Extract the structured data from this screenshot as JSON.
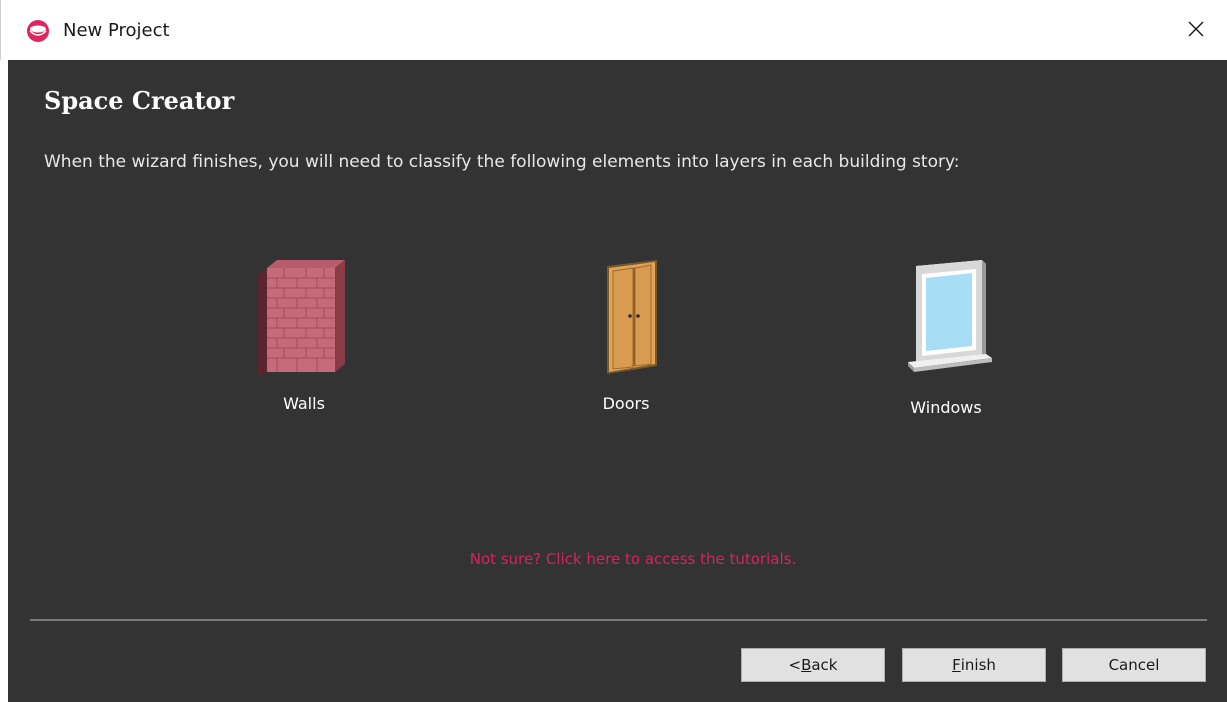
{
  "window": {
    "title": "New Project",
    "app_icon": "app-logo-icon",
    "close_icon": "close-icon"
  },
  "page": {
    "heading": "Space Creator",
    "instruction": "When the wizard finishes, you will need to classify the following elements into layers in each building story:"
  },
  "elements": [
    {
      "label": "Walls",
      "icon": "wall-icon"
    },
    {
      "label": "Doors",
      "icon": "door-icon"
    },
    {
      "label": "Windows",
      "icon": "window-icon"
    }
  ],
  "tutorial_link": "Not sure? Click here to access the tutorials.",
  "buttons": {
    "back": {
      "prefix": "< ",
      "mnemonic": "B",
      "rest": "ack"
    },
    "finish": {
      "mnemonic": "F",
      "rest": "inish"
    },
    "cancel": {
      "label": "Cancel"
    }
  },
  "colors": {
    "content_bg": "#333333",
    "link": "#d1265a",
    "accent": "#e0245e"
  }
}
